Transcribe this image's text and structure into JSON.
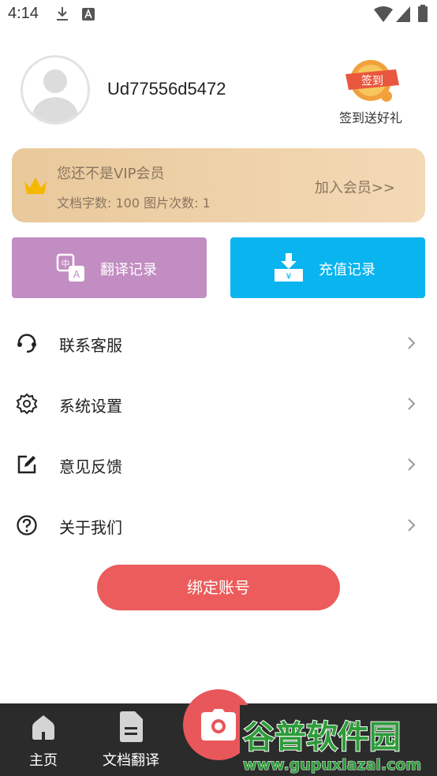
{
  "status_bar": {
    "time": "4:14"
  },
  "profile": {
    "username": "Ud77556d5472",
    "checkin_badge": "签到",
    "checkin_label": "签到送好礼"
  },
  "vip": {
    "title": "您还不是VIP会员",
    "stats": "文档字数: 100  图片次数: 1",
    "join": "加入会员>>"
  },
  "actions": {
    "translate": "翻译记录",
    "recharge": "充值记录"
  },
  "menu": [
    {
      "label": "联系客服"
    },
    {
      "label": "系统设置"
    },
    {
      "label": "意见反馈"
    },
    {
      "label": "关于我们"
    }
  ],
  "bind_button": "绑定账号",
  "bottom_nav": {
    "home": "主页",
    "doc_translate": "文档翻译"
  },
  "watermark": {
    "brand": "谷普软件园",
    "url": "www.gupuxlazal.com"
  },
  "colors": {
    "vip_gradient_start": "#e9c99b",
    "translate": "#c28dc2",
    "recharge": "#09b4ef",
    "bind": "#ec5c5c",
    "nav_bg": "#2b2b2b"
  }
}
